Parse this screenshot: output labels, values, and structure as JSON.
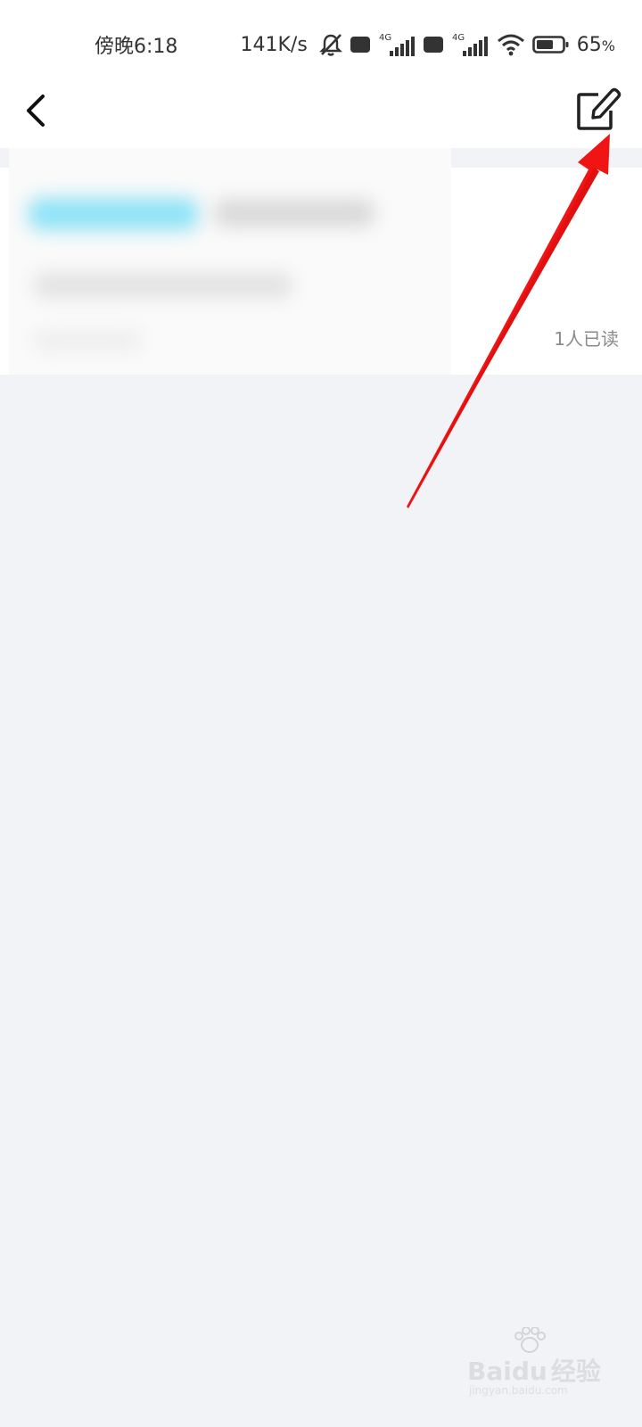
{
  "status_bar": {
    "time": "傍晚6:18",
    "net_speed": "141K/s",
    "battery_percent": "65",
    "battery_unit": "%",
    "network_labels": [
      "HD",
      "4G",
      "HD",
      "4G"
    ],
    "icons": [
      "mute-bell-icon",
      "hd-icon",
      "signal-4g-icon",
      "hd-icon",
      "signal-4g-icon",
      "wifi-icon",
      "battery-icon"
    ]
  },
  "header": {
    "back_icon": "chevron-left-icon",
    "edit_icon": "edit-compose-icon"
  },
  "message": {
    "read_status": "1人已读"
  },
  "annotation": {
    "color": "#f01414"
  },
  "watermark": {
    "brand": "Bai",
    "brand_suffix": "du",
    "brand_cn": "经验",
    "url": "jingyan.baidu.com"
  },
  "colors": {
    "background": "#f2f3f7",
    "card": "#ffffff",
    "accent_blur": "#8fe3f6"
  }
}
